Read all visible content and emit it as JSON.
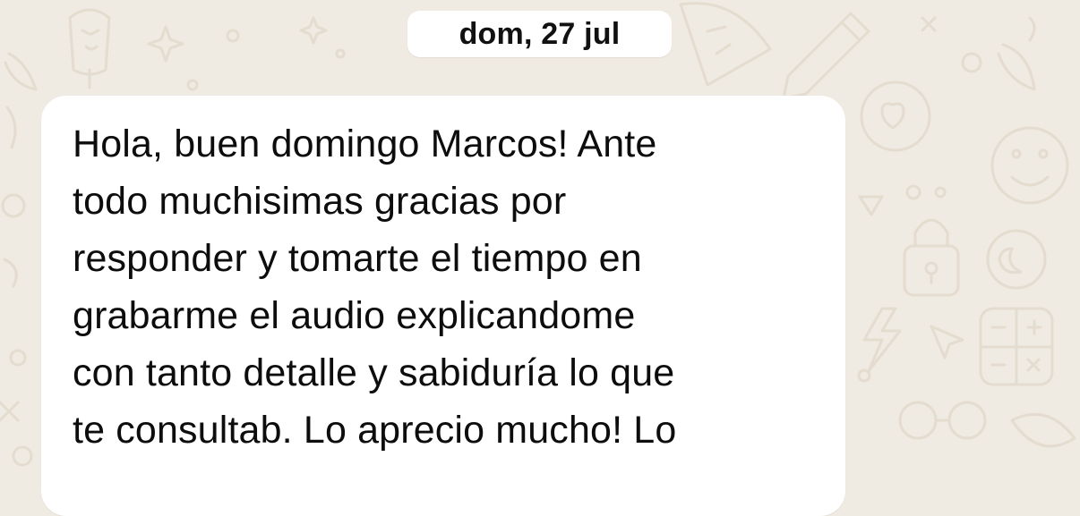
{
  "chat": {
    "date_separator": "dom, 27 jul",
    "messages": [
      {
        "direction": "incoming",
        "text": "Hola, buen domingo Marcos! Ante\ntodo muchisimas gracias por\nresponder y tomarte el tiempo en\ngrabarme el audio explicandome\ncon tanto detalle y sabiduría lo que\nte consultab. Lo aprecio mucho! Lo"
      }
    ]
  },
  "theme": {
    "wallpaper_color": "#efeae2",
    "wallpaper_doodle_color": "#e3dccf",
    "bubble_color": "#ffffff",
    "text_color": "#0d0d0d"
  },
  "icons": {
    "wallpaper_doodles": [
      "smiley-icon",
      "heart-icon",
      "lock-icon",
      "pencil-icon",
      "sparkle-icon",
      "chili-icon",
      "moon-icon",
      "lightning-icon",
      "cursor-icon",
      "calculator-icon",
      "glasses-icon",
      "ice-cream-icon"
    ]
  }
}
